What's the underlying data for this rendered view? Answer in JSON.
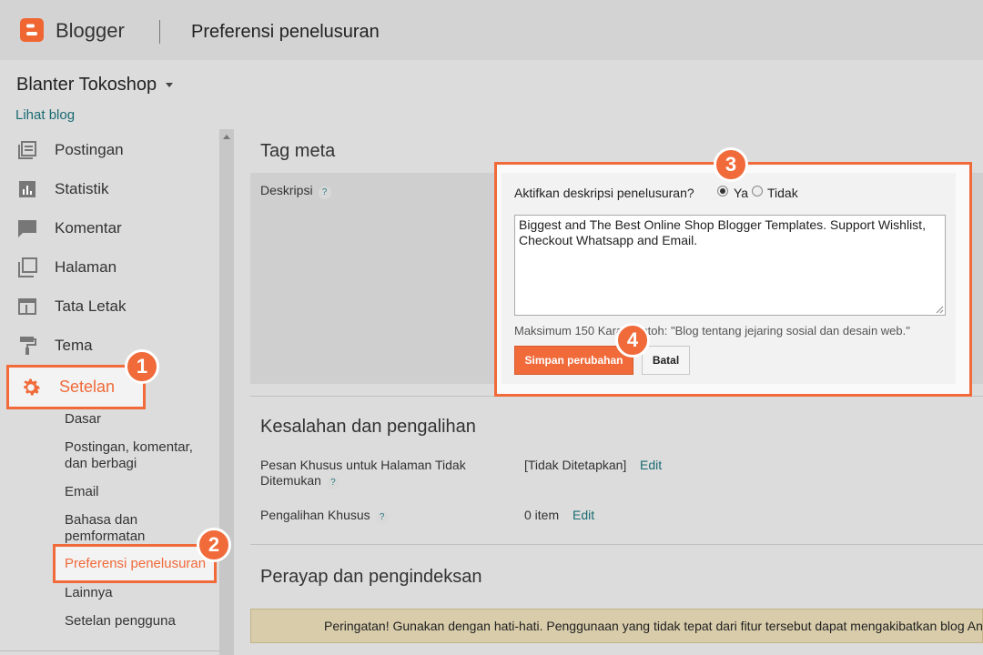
{
  "header": {
    "app_name": "Blogger",
    "page_title": "Preferensi penelusuran"
  },
  "blog": {
    "name": "Blanter Tokoshop",
    "view_link": "Lihat blog"
  },
  "sidebar": {
    "items": [
      {
        "label": "Postingan",
        "icon": "posts-icon"
      },
      {
        "label": "Statistik",
        "icon": "stats-icon"
      },
      {
        "label": "Komentar",
        "icon": "comments-icon"
      },
      {
        "label": "Halaman",
        "icon": "pages-icon"
      },
      {
        "label": "Tata Letak",
        "icon": "layout-icon"
      },
      {
        "label": "Tema",
        "icon": "theme-icon"
      },
      {
        "label": "Setelan",
        "icon": "gear-icon"
      }
    ],
    "sub_items": [
      "Dasar",
      "Postingan, komentar, dan berbagi",
      "Email",
      "Bahasa dan pemformatan",
      "Preferensi penelusuran",
      "Lainnya",
      "Setelan pengguna"
    ]
  },
  "meta": {
    "section_title": "Tag meta",
    "field_label": "Deskripsi",
    "help": "?",
    "question": "Aktifkan deskripsi penelusuran?",
    "option_yes": "Ya",
    "option_no": "Tidak",
    "selected": "Ya",
    "description": "Biggest and The Best Online Shop Blogger Templates. Support Wishlist, Checkout Whatsapp and Email.",
    "hint": "Maksimum 150 Kara        Contoh: \"Blog tentang jejaring sosial dan desain web.\"",
    "save_label": "Simpan perubahan",
    "cancel_label": "Batal"
  },
  "errors": {
    "section_title": "Kesalahan dan pengalihan",
    "not_found_label": "Pesan Khusus untuk Halaman Tidak Ditemukan",
    "not_found_value": "[Tidak Ditetapkan]",
    "redirect_label": "Pengalihan Khusus",
    "redirect_value": "0 item",
    "edit_label": "Edit"
  },
  "crawl": {
    "section_title": "Perayap dan pengindeksan",
    "warning": "Peringatan! Gunakan dengan hati-hati. Penggunaan yang tidak tepat dari fitur tersebut dapat mengakibatkan blog An"
  },
  "callouts": [
    "1",
    "2",
    "3",
    "4"
  ],
  "colors": {
    "accent": "#f06a3a",
    "link": "#1a6b73",
    "warning_bg": "#d8ccaa"
  }
}
